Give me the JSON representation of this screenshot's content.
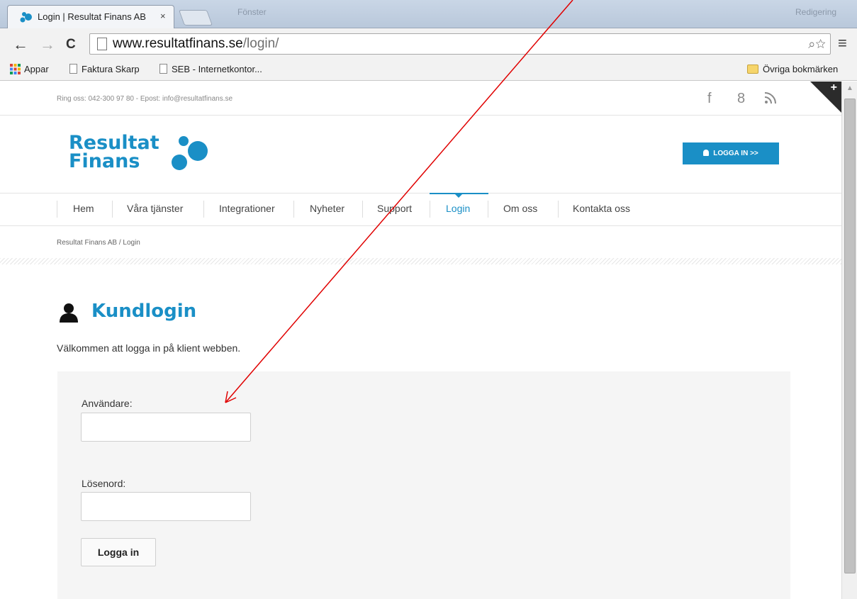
{
  "browser": {
    "tab_title": "Login | Resultat Finans AB",
    "tab_close": "×",
    "faded_tab_text_1": "Fönster",
    "faded_tab_text_2": "Redigering",
    "url_host": "www.resultatfinans.se",
    "url_path": "/login/",
    "omni_icons": "⌕☆",
    "menu_icon": "≡",
    "back": "←",
    "forward": "→",
    "reload": "C",
    "bookmarks": [
      {
        "label": "Appar",
        "icon": "apps-grid-icon"
      },
      {
        "label": "Faktura Skarp",
        "icon": "page-icon"
      },
      {
        "label": "SEB - Internetkontor...",
        "icon": "page-icon"
      }
    ],
    "other_bookmarks": "Övriga bokmärken"
  },
  "header": {
    "contact": "Ring oss: 042-300 97 80 - Epost: info@resultatfinans.se",
    "social": {
      "facebook": "f",
      "google": "8",
      "rss": "ᯤ"
    },
    "corner_plus": "+",
    "logo_line1": "Resultat",
    "logo_line2": "Finans",
    "login_button": "LOGGA IN >>"
  },
  "nav": {
    "items": [
      "Hem",
      "Våra tjänster",
      "Integrationer",
      "Nyheter",
      "Support",
      "Login",
      "Om oss",
      "Kontakta oss"
    ],
    "active": "Login"
  },
  "breadcrumb": "Resultat Finans AB / Login",
  "main": {
    "title": "Kundlogin",
    "intro": "Välkommen att logga in på klient webben.",
    "form": {
      "user_label": "Användare:",
      "user_value": "",
      "password_label": "Lösenord:",
      "password_value": "",
      "submit": "Logga in"
    }
  },
  "colors": {
    "brand": "#1a8fc6",
    "annotation": "#e00000"
  }
}
